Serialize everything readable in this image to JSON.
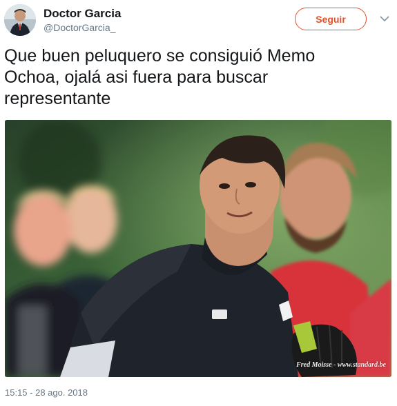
{
  "author": {
    "display_name": "Doctor Garcia",
    "handle": "@DoctorGarcia_"
  },
  "actions": {
    "follow_label": "Seguir",
    "more_icon": "chevron-down-icon"
  },
  "tweet": {
    "text": "Que buen peluquero se consiguió Memo\nOchoa, ojalá asi fuera para buscar\nrepresentante",
    "timestamp": "15:15 - 28 ago. 2018"
  },
  "media": {
    "watermark": "Fred Moisse - www.standard.be"
  },
  "colors": {
    "accent": "#e0522b",
    "text_primary": "#14171a",
    "text_secondary": "#657786"
  }
}
